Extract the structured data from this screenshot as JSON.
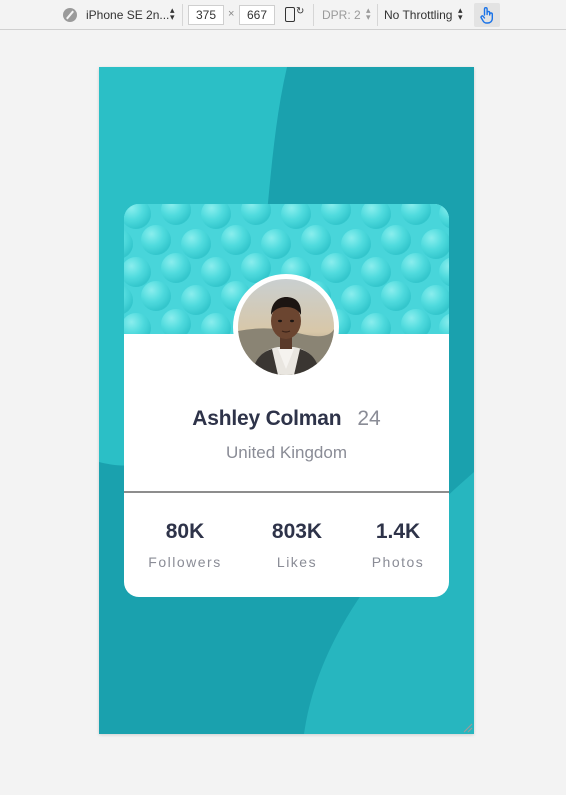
{
  "devtools": {
    "device": "iPhone SE 2n...",
    "width": "375",
    "times": "×",
    "height": "667",
    "dpr": "DPR: 2",
    "throttling": "No Throttling"
  },
  "profile": {
    "name": "Ashley Colman",
    "age": "24",
    "location": "United Kingdom"
  },
  "stats": [
    {
      "value": "80K",
      "label": "Followers"
    },
    {
      "value": "803K",
      "label": "Likes"
    },
    {
      "value": "1.4K",
      "label": "Photos"
    }
  ],
  "colors": {
    "background": "#1aa1ae",
    "header": "#4ad7db",
    "card": "#ffffff",
    "text_dark": "#2e3349",
    "text_muted": "#8a8c96"
  }
}
